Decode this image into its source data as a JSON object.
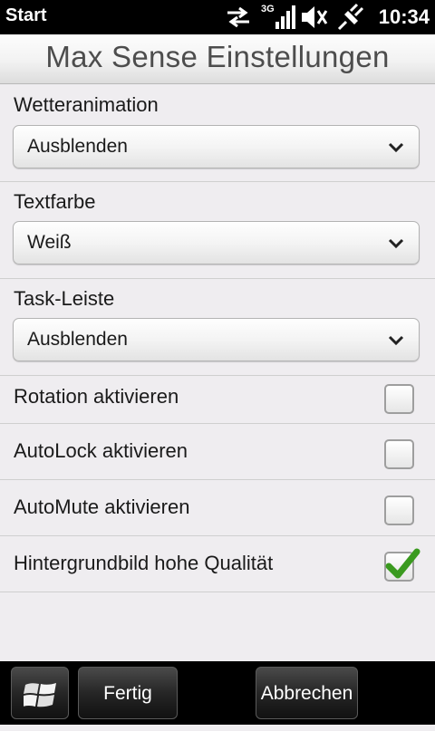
{
  "status_bar": {
    "title": "Start",
    "clock": "10:34",
    "network": "3G",
    "icons": [
      "data-transfer-icon",
      "signal-strength-icon",
      "sound-muted-icon",
      "charging-plug-icon"
    ]
  },
  "header": {
    "title": "Max Sense Einstellungen"
  },
  "settings": {
    "weather": {
      "label": "Wetteranimation",
      "value": "Ausblenden"
    },
    "text_color": {
      "label": "Textfarbe",
      "value": "Weiß"
    },
    "taskbar": {
      "label": "Task-Leiste",
      "value": "Ausblenden"
    },
    "rotation": {
      "label": "Rotation aktivieren",
      "checked": false
    },
    "autolock": {
      "label": "AutoLock aktivieren",
      "checked": false
    },
    "automute": {
      "label": "AutoMute aktivieren",
      "checked": false
    },
    "hq_wallpaper": {
      "label": "Hintergrundbild hohe Qualität",
      "checked": true
    }
  },
  "bottom_bar": {
    "start_icon": "windows-flag-icon",
    "done_label": "Fertig",
    "cancel_label": "Abbrechen"
  },
  "colors": {
    "background": "#efedf0",
    "checkmark": "#3a9a1f",
    "status_bar": "#000000"
  }
}
